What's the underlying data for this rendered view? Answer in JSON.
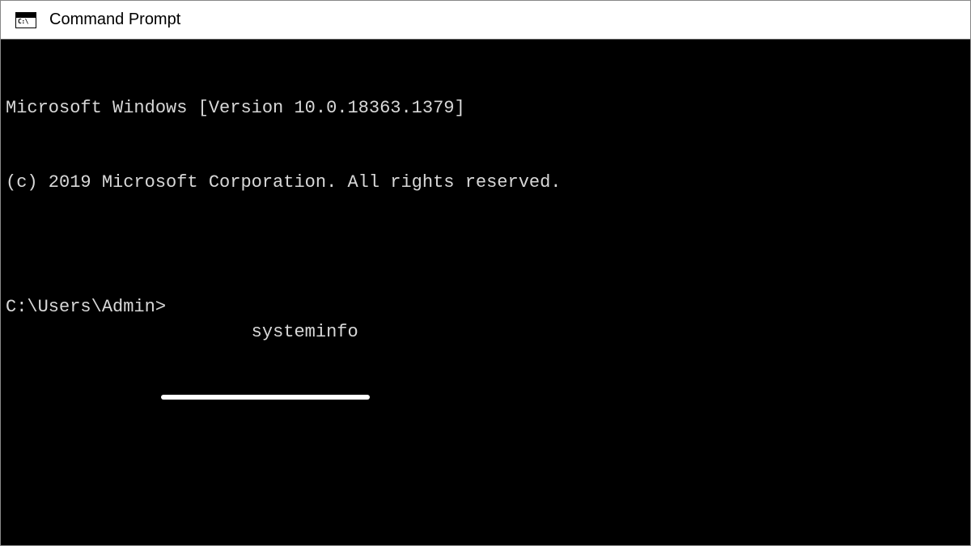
{
  "titlebar": {
    "icon_label": "C:\\",
    "title": "Command Prompt"
  },
  "terminal": {
    "banner_line1": "Microsoft Windows [Version 10.0.18363.1379]",
    "banner_line2": "(c) 2019 Microsoft Corporation. All rights reserved.",
    "blank": "",
    "prompt": "C:\\Users\\Admin>",
    "command": "systeminfo"
  }
}
